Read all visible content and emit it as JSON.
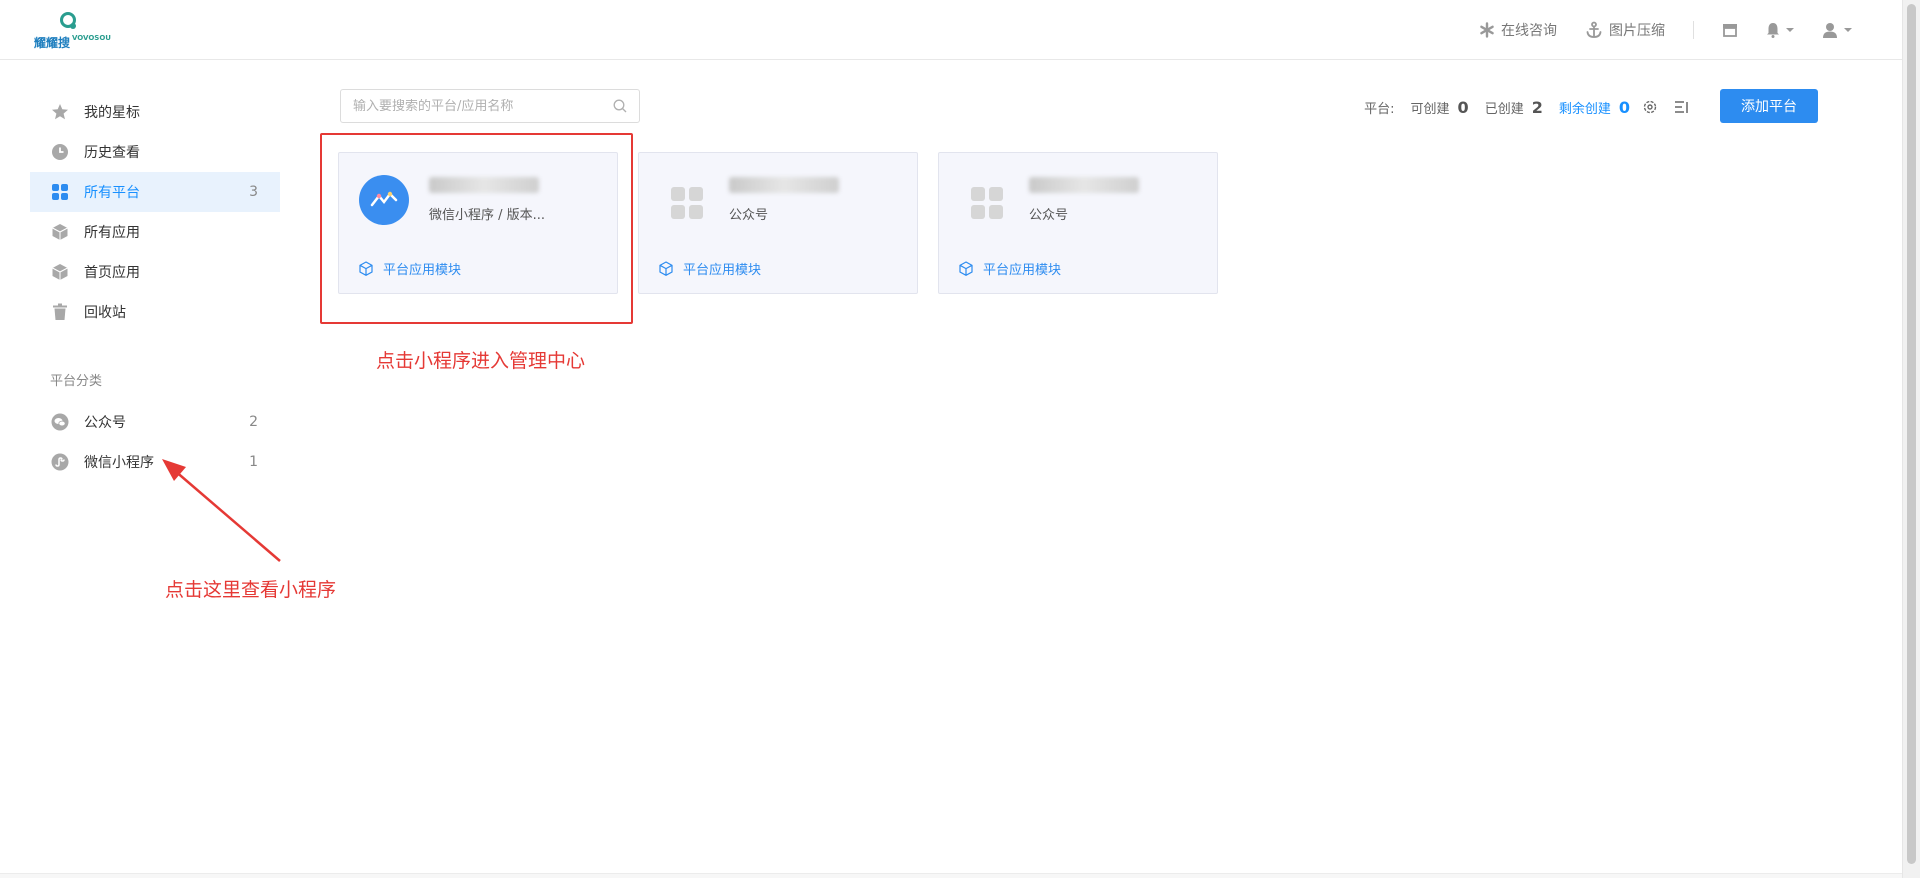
{
  "header": {
    "logo_text": "耀耀搜",
    "logo_subtext": "VOVOSOU",
    "nav": [
      {
        "label": "在线咨询",
        "icon": "asterisk-icon"
      },
      {
        "label": "图片压缩",
        "icon": "anchor-icon"
      }
    ],
    "icons": [
      "store-icon",
      "bell-icon",
      "user-icon"
    ]
  },
  "sidebar": {
    "items": [
      {
        "label": "我的星标",
        "icon": "star-icon",
        "count": ""
      },
      {
        "label": "历史查看",
        "icon": "clock-icon",
        "count": ""
      },
      {
        "label": "所有平台",
        "icon": "grid-icon",
        "count": "3",
        "active": true
      },
      {
        "label": "所有应用",
        "icon": "cube-icon",
        "count": ""
      },
      {
        "label": "首页应用",
        "icon": "cube-icon",
        "count": ""
      },
      {
        "label": "回收站",
        "icon": "trash-icon",
        "count": ""
      }
    ],
    "section_title": "平台分类",
    "categories": [
      {
        "label": "公众号",
        "icon": "wechat-icon",
        "count": "2"
      },
      {
        "label": "微信小程序",
        "icon": "miniprogram-icon",
        "count": "1"
      }
    ]
  },
  "toolbar": {
    "search_placeholder": "输入要搜索的平台/应用名称",
    "stats": {
      "platform_label": "平台:",
      "can_create_label": "可创建",
      "can_create": "0",
      "created_label": "已创建",
      "created": "2",
      "remaining_label": "剩余创建",
      "remaining": "0"
    },
    "add_button": "添加平台"
  },
  "cards": [
    {
      "subtitle": "微信小程序 / 版本...",
      "module_label": "平台应用模块",
      "avatar": "miniprogram-avatar"
    },
    {
      "subtitle": "公众号",
      "module_label": "平台应用模块",
      "avatar": "grid-avatar"
    },
    {
      "subtitle": "公众号",
      "module_label": "平台应用模块",
      "avatar": "grid-avatar"
    }
  ],
  "annotations": {
    "card_hint": "点击小程序进入管理中心",
    "sidebar_hint": "点击这里查看小程序"
  },
  "colors": {
    "accent": "#2d8cf0",
    "active_bg": "#e8f2fd",
    "annotation_red": "#e53935",
    "card_bg": "#f5f6fc"
  }
}
